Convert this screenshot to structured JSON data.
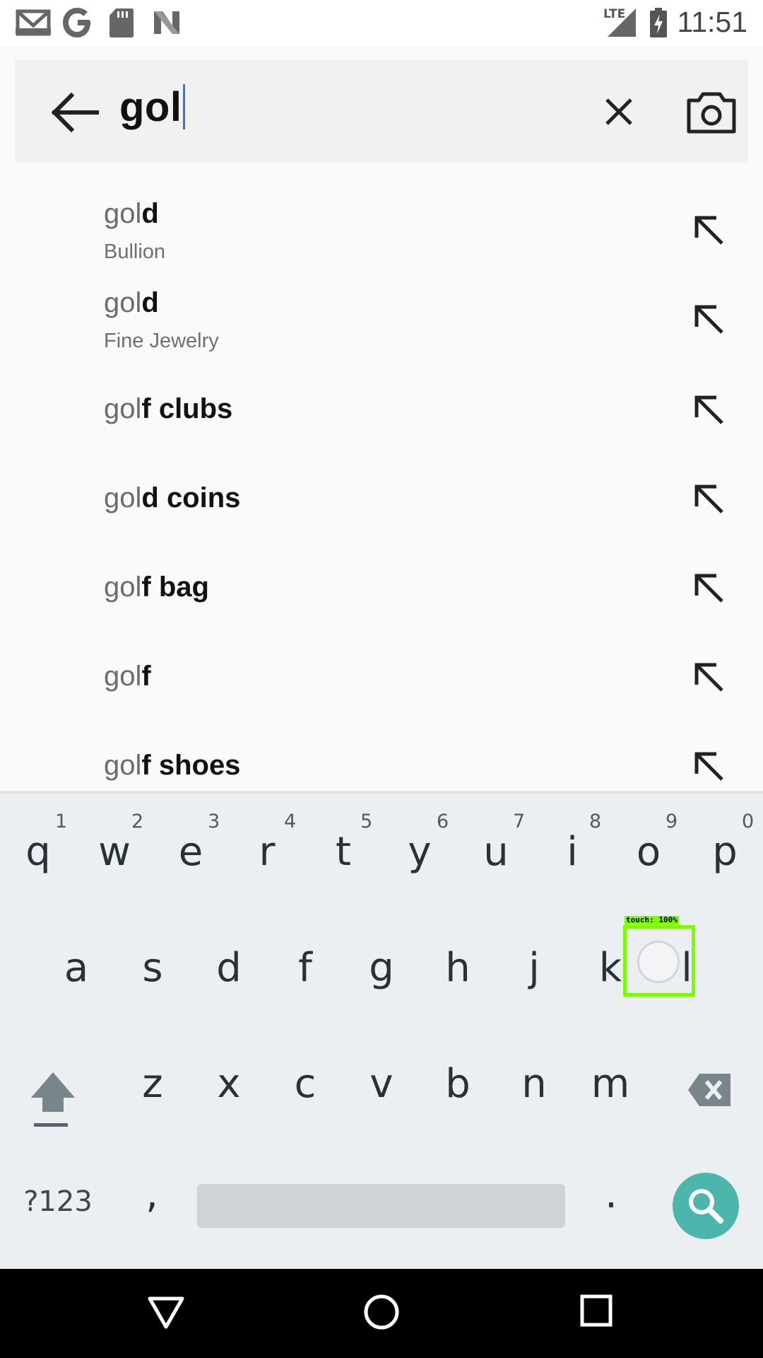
{
  "status_bar": {
    "time": "11:51",
    "network": "LTE",
    "icons": [
      "gmail-icon",
      "google-icon",
      "sd-card-icon",
      "n-icon",
      "signal-icon",
      "battery-charging-icon"
    ]
  },
  "search": {
    "query": "gol",
    "back_icon": "arrow-back-icon",
    "clear_icon": "close-icon",
    "camera_icon": "camera-icon"
  },
  "suggestions": [
    {
      "prefix": "gol",
      "rest": "d",
      "subtitle": "Bullion"
    },
    {
      "prefix": "gol",
      "rest": "d",
      "subtitle": "Fine Jewelry"
    },
    {
      "prefix": "gol",
      "rest": "f clubs",
      "subtitle": ""
    },
    {
      "prefix": "gol",
      "rest": "d coins",
      "subtitle": ""
    },
    {
      "prefix": "gol",
      "rest": "f bag",
      "subtitle": ""
    },
    {
      "prefix": "gol",
      "rest": "f",
      "subtitle": ""
    },
    {
      "prefix": "gol",
      "rest": "f shoes",
      "subtitle": ""
    }
  ],
  "keyboard": {
    "row1": [
      "q",
      "w",
      "e",
      "r",
      "t",
      "y",
      "u",
      "i",
      "o",
      "p"
    ],
    "row1_hints": [
      "1",
      "2",
      "3",
      "4",
      "5",
      "6",
      "7",
      "8",
      "9",
      "0"
    ],
    "row2": [
      "a",
      "s",
      "d",
      "f",
      "g",
      "h",
      "j",
      "k",
      "l"
    ],
    "row3": [
      "z",
      "x",
      "c",
      "v",
      "b",
      "n",
      "m"
    ],
    "symbols_label": "?123",
    "comma": ",",
    "period": "."
  },
  "touch_overlay": {
    "label": "touch: 100%"
  }
}
